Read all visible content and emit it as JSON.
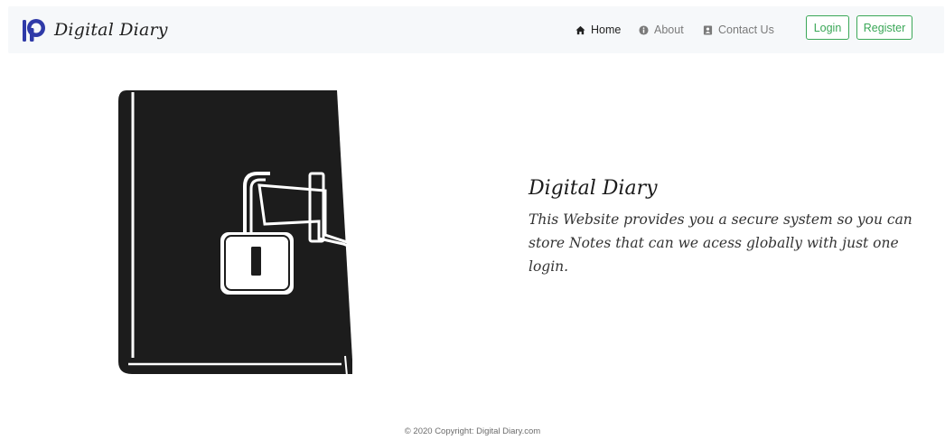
{
  "navbar": {
    "brand": {
      "logo_icon": "p-logo-icon",
      "name": "Digital Diary"
    },
    "links": [
      {
        "label": "Home",
        "icon": "home-icon",
        "active": true
      },
      {
        "label": "About",
        "icon": "info-icon",
        "active": false
      },
      {
        "label": "Contact Us",
        "icon": "contact-book-icon",
        "active": false
      }
    ],
    "login_label": "Login",
    "register_label": "Register"
  },
  "hero": {
    "image_icon": "locked-diary-icon",
    "title": "Digital Diary",
    "description": "This Website provides you a secure system so you can store Notes that can we acess globally with just one login."
  },
  "footer": {
    "text": "© 2020 Copyright: Digital Diary.com"
  },
  "colors": {
    "navbar_bg": "#f6f8fa",
    "logo_blue": "#2f3aa8",
    "button_green": "#3aa757",
    "diary_black": "#1c1c1c"
  }
}
